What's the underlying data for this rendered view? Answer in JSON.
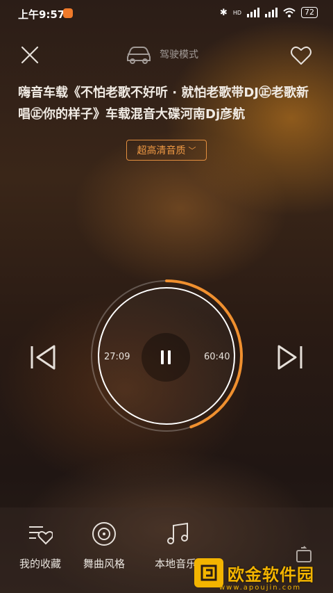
{
  "status_bar": {
    "time": "上午9:57",
    "network": "HD",
    "battery": "72"
  },
  "header": {
    "drive_mode_label": "驾驶模式"
  },
  "song": {
    "title": "嗨音车载《不怕老歌不好听 · 就怕老歌带DJ㊣老歌新唱㊣你的样子》车载混音大碟河南Dj彦航"
  },
  "quality": {
    "label": "超高清音质"
  },
  "player": {
    "elapsed": "27:09",
    "total": "60:40",
    "progress": 0.447,
    "accent_color": "#f0902f"
  },
  "nav": {
    "items": [
      {
        "label": "我的收藏",
        "icon": "heart-list-icon"
      },
      {
        "label": "舞曲风格",
        "icon": "disc-icon"
      },
      {
        "label": "本地音乐(",
        "icon": "music-note-icon"
      }
    ]
  },
  "watermark": {
    "text": "欧金软件园",
    "url": "www.apoujin.com"
  }
}
